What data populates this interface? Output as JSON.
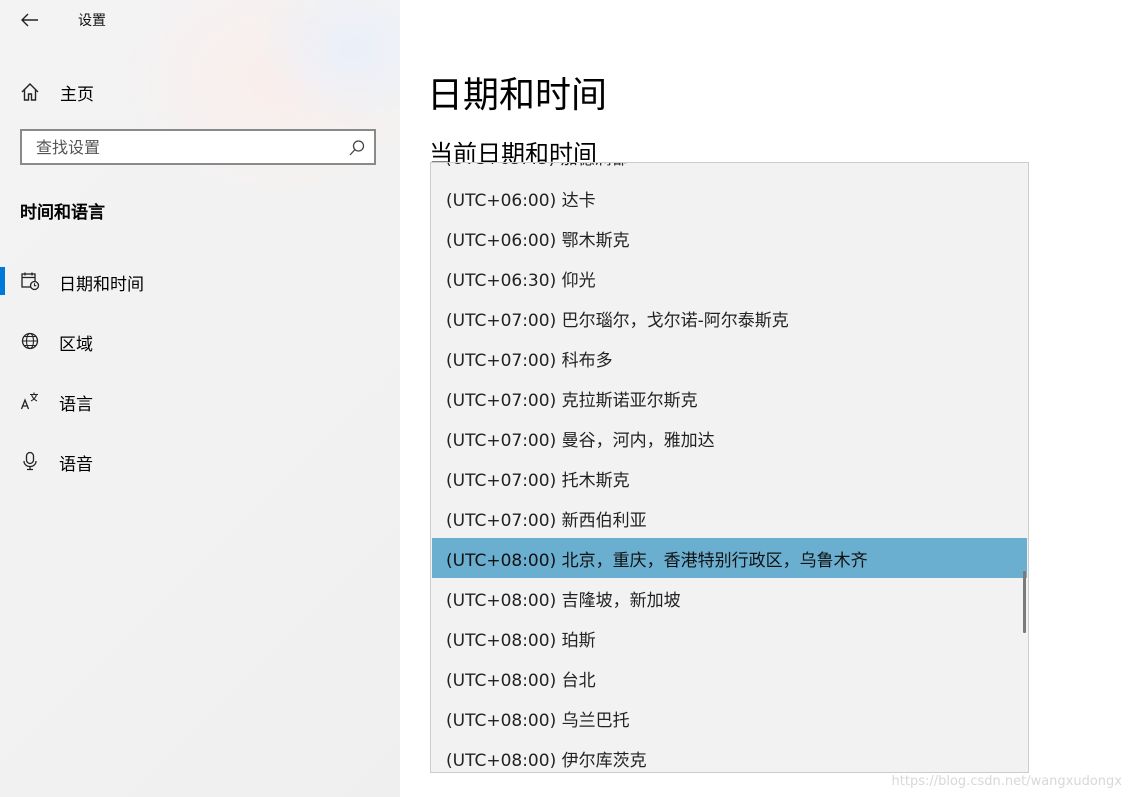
{
  "window": {
    "title": "设置"
  },
  "sidebar": {
    "home_label": "主页",
    "search_placeholder": "查找设置",
    "section_title": "时间和语言",
    "items": [
      {
        "label": "日期和时间",
        "icon": "calendar-clock-icon",
        "active": true
      },
      {
        "label": "区域",
        "icon": "globe-icon",
        "active": false
      },
      {
        "label": "语言",
        "icon": "language-icon",
        "active": false
      },
      {
        "label": "语音",
        "icon": "microphone-icon",
        "active": false
      }
    ]
  },
  "main": {
    "page_title": "日期和时间",
    "sub_title": "当前日期和时间"
  },
  "timezone_list": {
    "items": [
      "(UTC+06:00) 达卡",
      "(UTC+06:00) 鄂木斯克",
      "(UTC+06:30) 仰光",
      "(UTC+07:00) 巴尔瑙尔，戈尔诺-阿尔泰斯克",
      "(UTC+07:00) 科布多",
      "(UTC+07:00) 克拉斯诺亚尔斯克",
      "(UTC+07:00) 曼谷，河内，雅加达",
      "(UTC+07:00) 托木斯克",
      "(UTC+07:00) 新西伯利亚",
      "(UTC+08:00) 北京，重庆，香港特别行政区，乌鲁木齐",
      "(UTC+08:00) 吉隆坡，新加坡",
      "(UTC+08:00) 珀斯",
      "(UTC+08:00) 台北",
      "(UTC+08:00) 乌兰巴托",
      "(UTC+08:00) 伊尔库茨克"
    ],
    "selected_index": 9
  },
  "colors": {
    "accent": "#0078d7",
    "selected_row": "#6aaed0",
    "list_bg": "#f2f2f2",
    "sidebar_bg": "#f2f2f2"
  },
  "watermark": "https://blog.csdn.net/wangxudongx"
}
